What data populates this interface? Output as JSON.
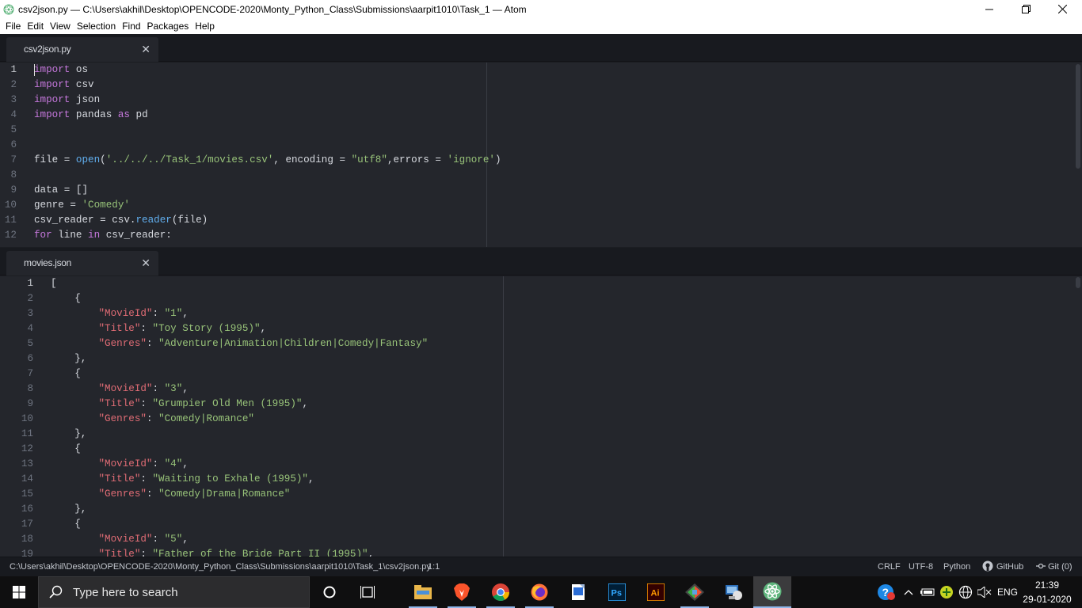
{
  "window": {
    "title": "csv2json.py — C:\\Users\\akhil\\Desktop\\OPENCODE-2020\\Monty_Python_Class\\Submissions\\aarpit1010\\Task_1 — Atom"
  },
  "menu": [
    "File",
    "Edit",
    "View",
    "Selection",
    "Find",
    "Packages",
    "Help"
  ],
  "pane_top": {
    "tab_label": "csv2json.py",
    "lines": [
      {
        "n": "1",
        "tokens": [
          [
            "kw",
            "import"
          ],
          [
            "pl",
            " os"
          ]
        ]
      },
      {
        "n": "2",
        "tokens": [
          [
            "kw",
            "import"
          ],
          [
            "pl",
            " csv"
          ]
        ]
      },
      {
        "n": "3",
        "tokens": [
          [
            "kw",
            "import"
          ],
          [
            "pl",
            " json"
          ]
        ]
      },
      {
        "n": "4",
        "tokens": [
          [
            "kw",
            "import"
          ],
          [
            "pl",
            " pandas "
          ],
          [
            "kw",
            "as"
          ],
          [
            "pl",
            " pd"
          ]
        ]
      },
      {
        "n": "5",
        "tokens": []
      },
      {
        "n": "6",
        "tokens": []
      },
      {
        "n": "7",
        "tokens": [
          [
            "pl",
            "file = "
          ],
          [
            "fn",
            "open"
          ],
          [
            "pl",
            "("
          ],
          [
            "str",
            "'../../../Task_1/movies.csv'"
          ],
          [
            "pl",
            ", encoding = "
          ],
          [
            "str",
            "\"utf8\""
          ],
          [
            "pl",
            ",errors = "
          ],
          [
            "str",
            "'ignore'"
          ],
          [
            "pl",
            ")"
          ]
        ]
      },
      {
        "n": "8",
        "tokens": []
      },
      {
        "n": "9",
        "tokens": [
          [
            "pl",
            "data = []"
          ]
        ]
      },
      {
        "n": "10",
        "tokens": [
          [
            "pl",
            "genre = "
          ],
          [
            "str",
            "'Comedy'"
          ]
        ]
      },
      {
        "n": "11",
        "tokens": [
          [
            "pl",
            "csv_reader = csv."
          ],
          [
            "fn",
            "reader"
          ],
          [
            "pl",
            "(file)"
          ]
        ]
      },
      {
        "n": "12",
        "tokens": [
          [
            "kw",
            "for"
          ],
          [
            "pl",
            " line "
          ],
          [
            "kw",
            "in"
          ],
          [
            "pl",
            " csv_reader:"
          ]
        ]
      }
    ]
  },
  "pane_bottom": {
    "tab_label": "movies.json",
    "lines": [
      {
        "n": "1",
        "tokens": [
          [
            "pl",
            "["
          ]
        ]
      },
      {
        "n": "2",
        "tokens": [
          [
            "pl",
            "    {"
          ]
        ]
      },
      {
        "n": "3",
        "tokens": [
          [
            "pl",
            "        "
          ],
          [
            "prop",
            "\"MovieId\""
          ],
          [
            "pl",
            ": "
          ],
          [
            "str",
            "\"1\""
          ],
          [
            "pl",
            ","
          ]
        ]
      },
      {
        "n": "4",
        "tokens": [
          [
            "pl",
            "        "
          ],
          [
            "prop",
            "\"Title\""
          ],
          [
            "pl",
            ": "
          ],
          [
            "str",
            "\"Toy Story (1995)\""
          ],
          [
            "pl",
            ","
          ]
        ]
      },
      {
        "n": "5",
        "tokens": [
          [
            "pl",
            "        "
          ],
          [
            "prop",
            "\"Genres\""
          ],
          [
            "pl",
            ": "
          ],
          [
            "str",
            "\"Adventure|Animation|Children|Comedy|Fantasy\""
          ]
        ]
      },
      {
        "n": "6",
        "tokens": [
          [
            "pl",
            "    },"
          ]
        ]
      },
      {
        "n": "7",
        "tokens": [
          [
            "pl",
            "    {"
          ]
        ]
      },
      {
        "n": "8",
        "tokens": [
          [
            "pl",
            "        "
          ],
          [
            "prop",
            "\"MovieId\""
          ],
          [
            "pl",
            ": "
          ],
          [
            "str",
            "\"3\""
          ],
          [
            "pl",
            ","
          ]
        ]
      },
      {
        "n": "9",
        "tokens": [
          [
            "pl",
            "        "
          ],
          [
            "prop",
            "\"Title\""
          ],
          [
            "pl",
            ": "
          ],
          [
            "str",
            "\"Grumpier Old Men (1995)\""
          ],
          [
            "pl",
            ","
          ]
        ]
      },
      {
        "n": "10",
        "tokens": [
          [
            "pl",
            "        "
          ],
          [
            "prop",
            "\"Genres\""
          ],
          [
            "pl",
            ": "
          ],
          [
            "str",
            "\"Comedy|Romance\""
          ]
        ]
      },
      {
        "n": "11",
        "tokens": [
          [
            "pl",
            "    },"
          ]
        ]
      },
      {
        "n": "12",
        "tokens": [
          [
            "pl",
            "    {"
          ]
        ]
      },
      {
        "n": "13",
        "tokens": [
          [
            "pl",
            "        "
          ],
          [
            "prop",
            "\"MovieId\""
          ],
          [
            "pl",
            ": "
          ],
          [
            "str",
            "\"4\""
          ],
          [
            "pl",
            ","
          ]
        ]
      },
      {
        "n": "14",
        "tokens": [
          [
            "pl",
            "        "
          ],
          [
            "prop",
            "\"Title\""
          ],
          [
            "pl",
            ": "
          ],
          [
            "str",
            "\"Waiting to Exhale (1995)\""
          ],
          [
            "pl",
            ","
          ]
        ]
      },
      {
        "n": "15",
        "tokens": [
          [
            "pl",
            "        "
          ],
          [
            "prop",
            "\"Genres\""
          ],
          [
            "pl",
            ": "
          ],
          [
            "str",
            "\"Comedy|Drama|Romance\""
          ]
        ]
      },
      {
        "n": "16",
        "tokens": [
          [
            "pl",
            "    },"
          ]
        ]
      },
      {
        "n": "17",
        "tokens": [
          [
            "pl",
            "    {"
          ]
        ]
      },
      {
        "n": "18",
        "tokens": [
          [
            "pl",
            "        "
          ],
          [
            "prop",
            "\"MovieId\""
          ],
          [
            "pl",
            ": "
          ],
          [
            "str",
            "\"5\""
          ],
          [
            "pl",
            ","
          ]
        ]
      },
      {
        "n": "19",
        "tokens": [
          [
            "pl",
            "        "
          ],
          [
            "prop",
            "\"Title\""
          ],
          [
            "pl",
            ": "
          ],
          [
            "str",
            "\"Father of the Bride Part II (1995)\""
          ],
          [
            "pl",
            ","
          ]
        ]
      }
    ]
  },
  "statusbar": {
    "path": "C:\\Users\\akhil\\Desktop\\OPENCODE-2020\\Monty_Python_Class\\Submissions\\aarpit1010\\Task_1\\csv2json.py",
    "cursor_pos": "1:1",
    "line_ending": "CRLF",
    "encoding": "UTF-8",
    "grammar": "Python",
    "github": "GitHub",
    "git": "Git (0)"
  },
  "taskbar": {
    "search_placeholder": "Type here to search",
    "lang": "ENG",
    "time": "21:39",
    "date": "29-01-2020"
  },
  "colors": {
    "keyword": "#c678dd",
    "string": "#98c379",
    "property": "#e06c75",
    "function": "#61afef",
    "editor_bg": "#24262c"
  },
  "icons": [
    "atom-icon",
    "minimize-icon",
    "maximize-icon",
    "close-icon",
    "windows-start-icon",
    "search-icon",
    "cortana-circle-icon",
    "task-view-icon",
    "file-explorer-icon",
    "brave-icon",
    "chrome-icon",
    "firefox-icon",
    "word-file-icon",
    "photoshop-icon",
    "illustrator-icon",
    "git-icon",
    "network-app-icon",
    "atom-taskbar-icon",
    "help-badge-icon",
    "chevron-up-icon",
    "battery-icon",
    "power-icon",
    "globe-icon",
    "speaker-muted-icon",
    "github-icon",
    "git-icon-small"
  ]
}
